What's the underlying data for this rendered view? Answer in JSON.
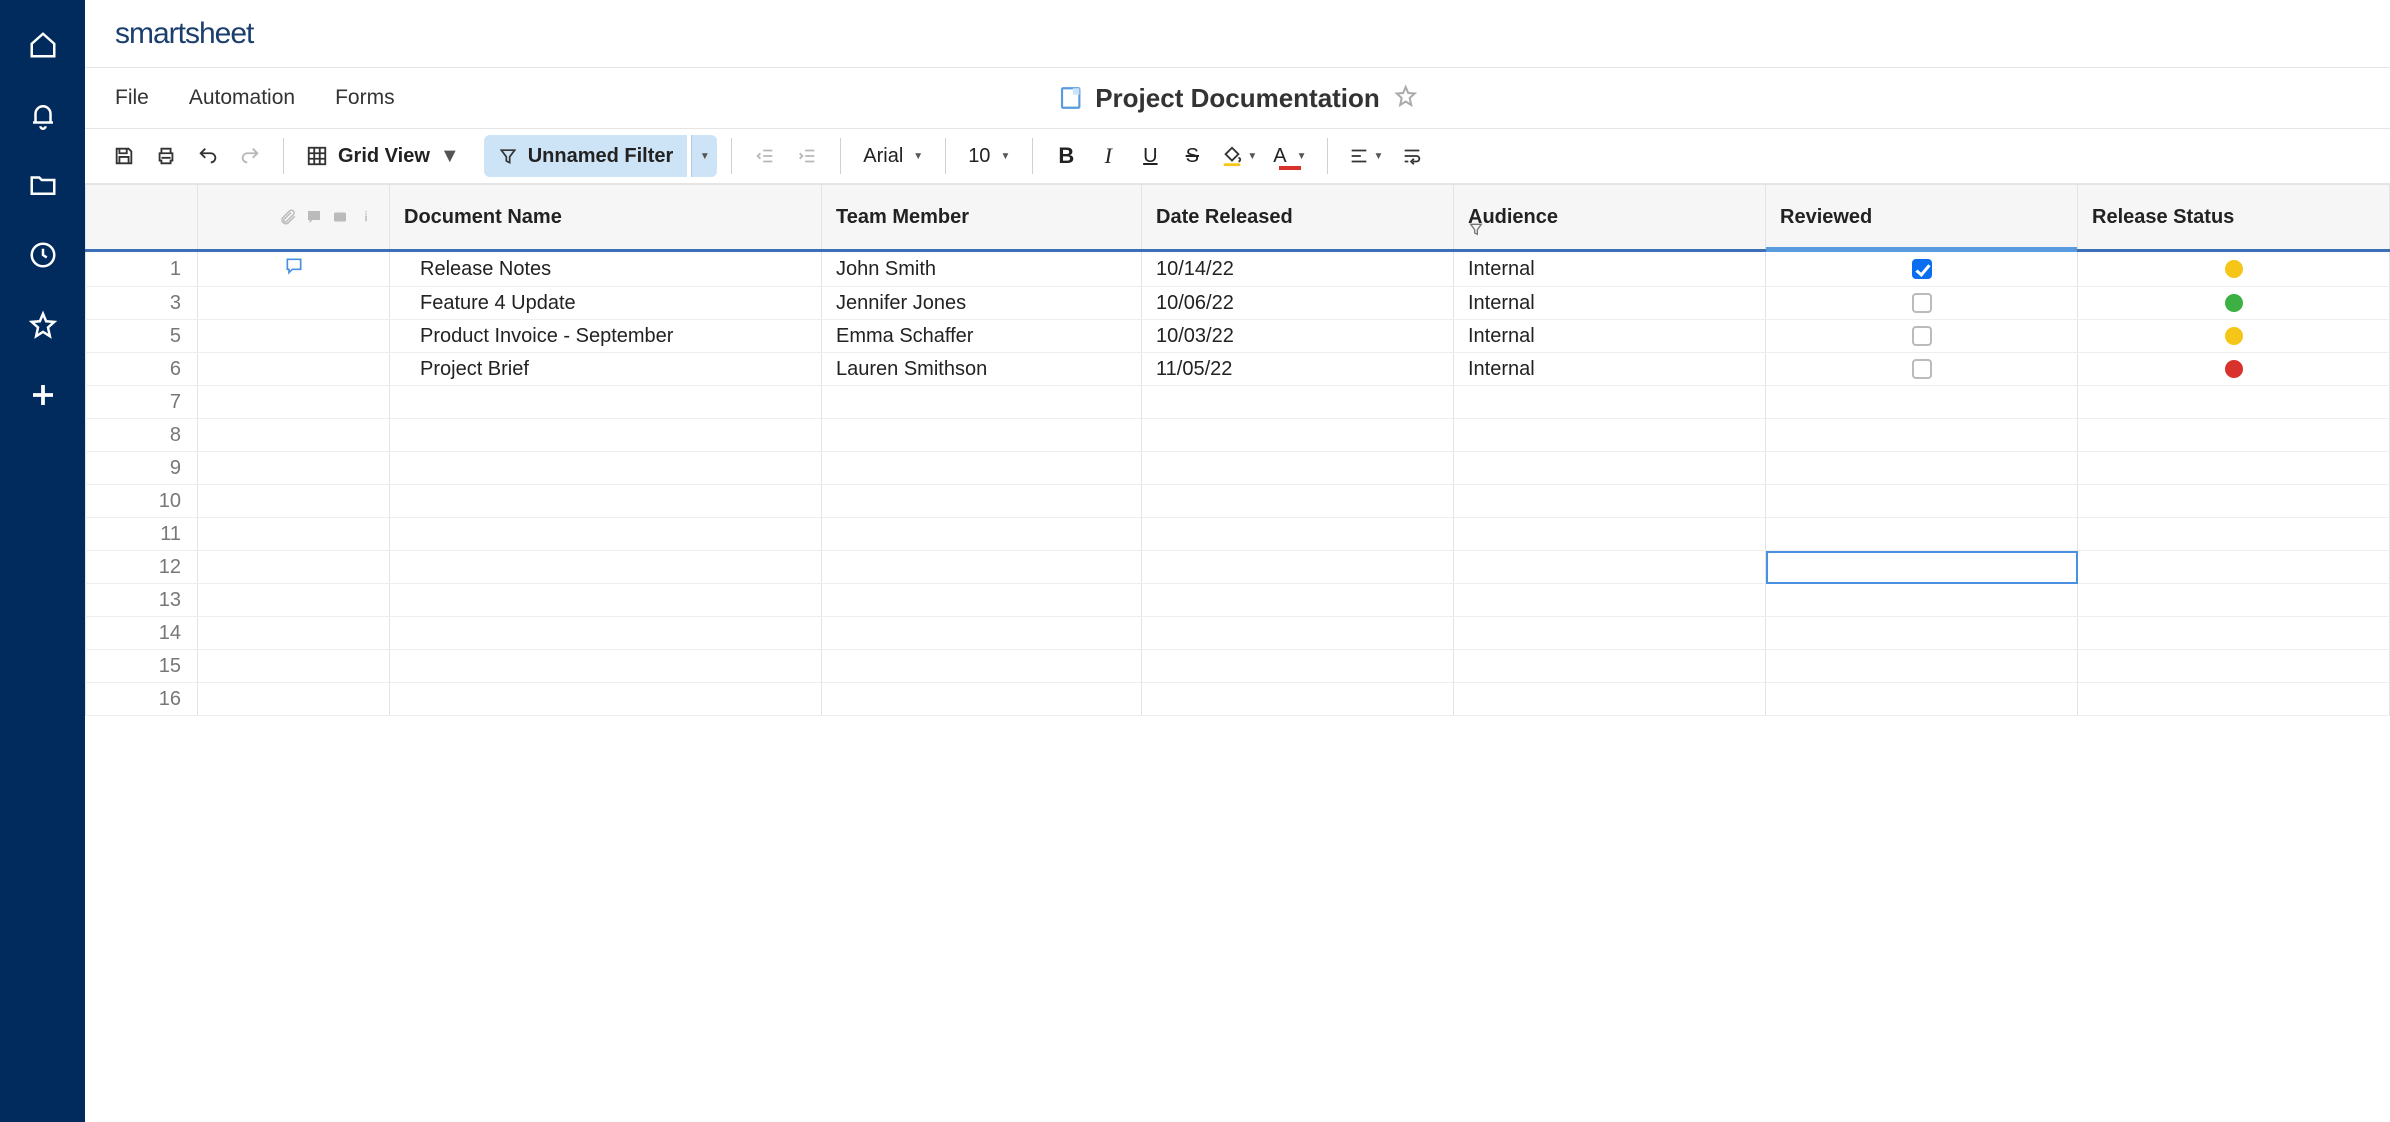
{
  "brand": "smartsheet",
  "menus": {
    "file": "File",
    "automation": "Automation",
    "forms": "Forms"
  },
  "document": {
    "title": "Project Documentation"
  },
  "toolbar": {
    "view_label": "Grid View",
    "filter_label": "Unnamed Filter",
    "font": "Arial",
    "font_size": "10"
  },
  "columns": {
    "doc_name": "Document Name",
    "team_member": "Team Member",
    "date_released": "Date Released",
    "audience": "Audience",
    "reviewed": "Reviewed",
    "release_status": "Release Status"
  },
  "rows": [
    {
      "num": "1",
      "doc": "Release Notes",
      "member": "John Smith",
      "date": "10/14/22",
      "aud": "Internal",
      "reviewed": true,
      "status": "yellow",
      "has_comment": true
    },
    {
      "num": "3",
      "doc": "Feature 4 Update",
      "member": "Jennifer Jones",
      "date": "10/06/22",
      "aud": "Internal",
      "reviewed": false,
      "status": "green"
    },
    {
      "num": "5",
      "doc": "Product Invoice - September",
      "member": "Emma Schaffer",
      "date": "10/03/22",
      "aud": "Internal",
      "reviewed": false,
      "status": "yellow"
    },
    {
      "num": "6",
      "doc": "Project Brief",
      "member": "Lauren Smithson",
      "date": "11/05/22",
      "aud": "Internal",
      "reviewed": false,
      "status": "red"
    }
  ],
  "empty_rows": [
    "7",
    "8",
    "9",
    "10",
    "11",
    "12",
    "13",
    "14",
    "15",
    "16"
  ],
  "selected_cell": {
    "row": "12",
    "col": "reviewed"
  }
}
